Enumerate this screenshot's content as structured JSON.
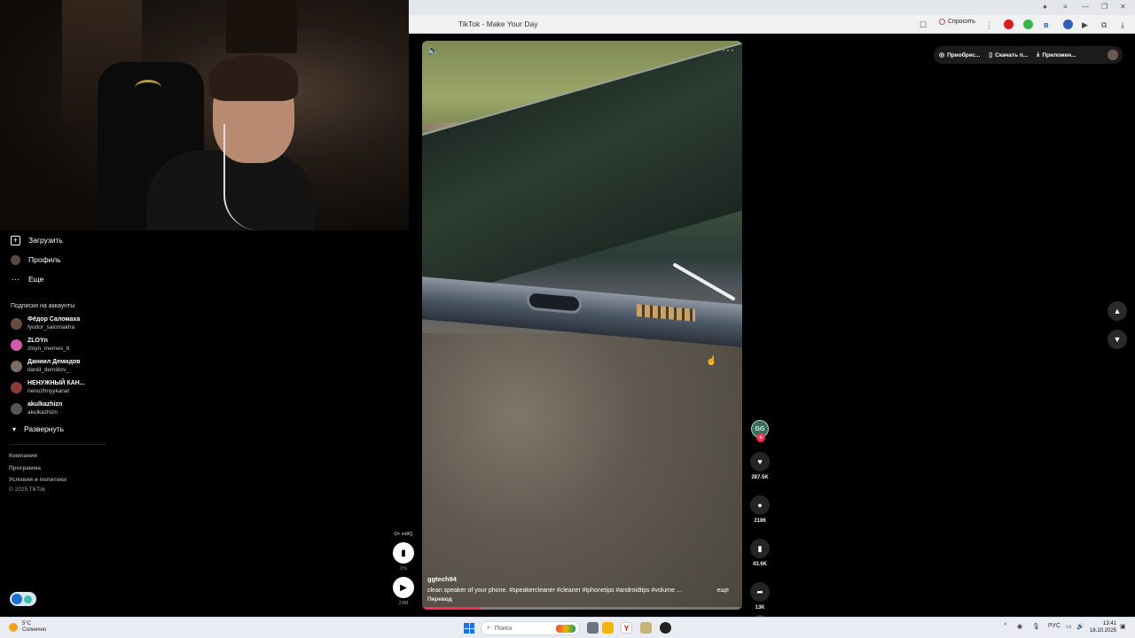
{
  "browser": {
    "tab_title": "TikTok - Make Your Day",
    "ask_label": "Спросить"
  },
  "sidebar": {
    "nav": [
      {
        "label": "Загрузить",
        "icon": "upload-icon"
      },
      {
        "label": "Профиль",
        "icon": "profile-avatar-icon"
      },
      {
        "label": "Еще",
        "icon": "more-dots-icon"
      }
    ],
    "following_title": "Подписки на аккаунты",
    "following": [
      {
        "name": "Фёдор Саломаха",
        "handle": "fyodor_salomakha",
        "color": "#6b4b3e"
      },
      {
        "name": "ZLOYn",
        "handle": "zloyn_memes_tt",
        "color": "#d25aa8"
      },
      {
        "name": "Даниил Демидов",
        "handle": "daniil_demidov_",
        "color": "#7c6c64"
      },
      {
        "name": "НЕНУЖНЫЙ КАН...",
        "handle": "nenuzhnyykanal",
        "color": "#8a3b3b"
      },
      {
        "name": "akulkazhizn",
        "handle": "akulkazhizn",
        "color": "#555555"
      }
    ],
    "expand_label": "Развернуть",
    "footer_links": [
      "Компания",
      "Программа",
      "Условия и политики"
    ],
    "copyright": "© 2025 TikTok"
  },
  "top_actions": {
    "buy": "Приобрес...",
    "download": "Скачать п...",
    "apps": "Приложен..."
  },
  "video": {
    "author": "ggtech94",
    "description": "clean speaker of your phone. #speakercleaner  #cleaner  #iphonetips  #androidtips  #volume  ...",
    "more_label": "еще",
    "translate_label": "Перевод",
    "progress": 0.18
  },
  "mini_player": {
    "from_label": "От vidIQ",
    "percent": "1%",
    "count": "29M"
  },
  "actions": {
    "author_initials": "GG",
    "likes": "287.5K",
    "comments": "2186",
    "saves": "43.6K",
    "shares": "13K"
  },
  "taskbar": {
    "temperature": "5°C",
    "condition": "Солнечно",
    "search_placeholder": "Поиск",
    "language": "РУС",
    "time": "13:41",
    "date": "18.10.2025"
  }
}
